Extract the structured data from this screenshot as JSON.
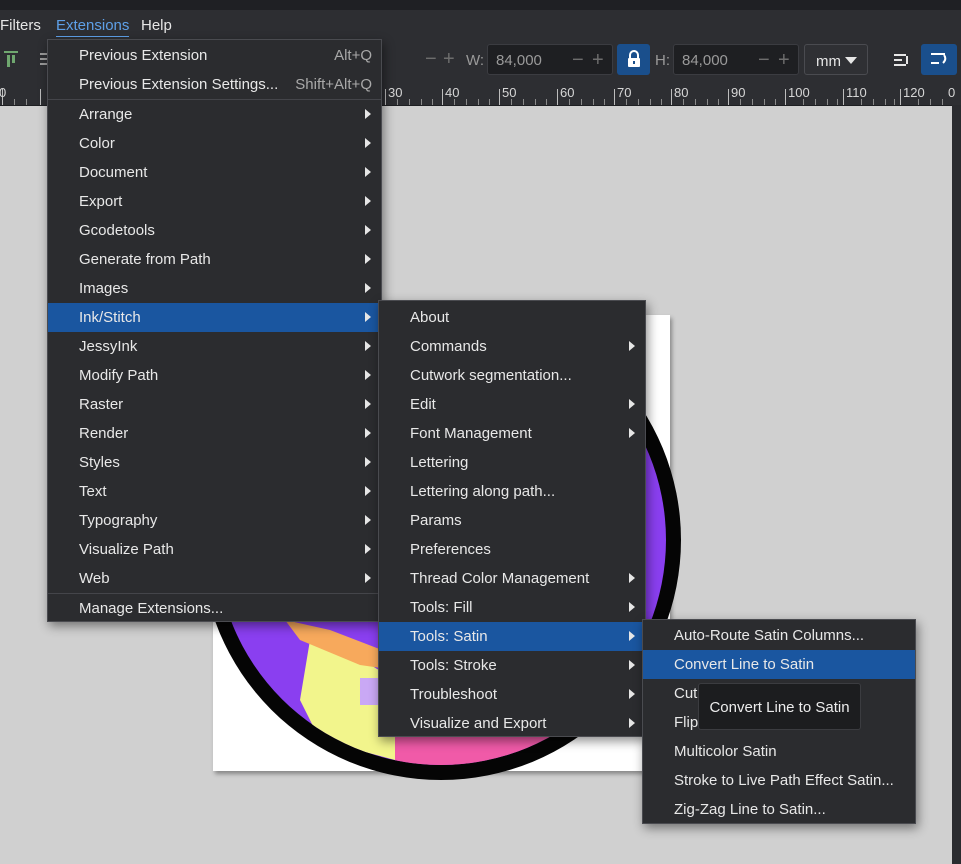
{
  "menubar": {
    "items": [
      "Filters",
      "Extensions",
      "Help"
    ]
  },
  "toolbar": {
    "w_label": "W:",
    "w_value": "84,000",
    "h_label": "H:",
    "h_value": "84,000",
    "unit": "mm",
    "minus": "−",
    "plus": "+"
  },
  "ruler": {
    "labels": [
      "0",
      "30",
      "40",
      "50",
      "60",
      "70",
      "80",
      "90",
      "100",
      "110",
      "120",
      "0"
    ]
  },
  "extensions_menu": {
    "previous_extension": {
      "label": "Previous Extension",
      "shortcut": "Alt+Q"
    },
    "previous_extension_settings": {
      "label": "Previous Extension Settings...",
      "shortcut": "Shift+Alt+Q"
    },
    "items": [
      "Arrange",
      "Color",
      "Document",
      "Export",
      "Gcodetools",
      "Generate from Path",
      "Images",
      "Ink/Stitch",
      "JessyInk",
      "Modify Path",
      "Raster",
      "Render",
      "Styles",
      "Text",
      "Typography",
      "Visualize Path",
      "Web"
    ],
    "highlighted": "Ink/Stitch",
    "manage": "Manage Extensions..."
  },
  "inkstitch_menu": {
    "items": [
      {
        "label": "About",
        "submenu": false
      },
      {
        "label": "Commands",
        "submenu": true
      },
      {
        "label": "Cutwork segmentation...",
        "submenu": false
      },
      {
        "label": "Edit",
        "submenu": true
      },
      {
        "label": "Font Management",
        "submenu": true
      },
      {
        "label": "Lettering",
        "submenu": false
      },
      {
        "label": "Lettering along path...",
        "submenu": false
      },
      {
        "label": "Params",
        "submenu": false
      },
      {
        "label": "Preferences",
        "submenu": false
      },
      {
        "label": "Thread Color Management",
        "submenu": true
      },
      {
        "label": "Tools: Fill",
        "submenu": true
      },
      {
        "label": "Tools: Satin",
        "submenu": true
      },
      {
        "label": "Tools: Stroke",
        "submenu": true
      },
      {
        "label": "Troubleshoot",
        "submenu": true
      },
      {
        "label": "Visualize and Export",
        "submenu": true
      }
    ],
    "highlighted": "Tools: Satin"
  },
  "satin_menu": {
    "items": [
      "Auto-Route Satin Columns...",
      "Convert Line to Satin",
      "Cut Satin Column",
      "Flip Satin Column Rails",
      "Multicolor Satin",
      "Stroke to Live Path Effect Satin...",
      "Zig-Zag Line to Satin..."
    ],
    "highlighted": "Convert Line to Satin"
  },
  "tooltip": "Convert Line to Satin",
  "icons": {
    "lock": "lock-icon",
    "unit_dropdown": "chevron-down-icon",
    "submenu": "chevron-right-icon"
  },
  "colors": {
    "menu_bg": "#2b2c2f",
    "highlight": "#1a56a0",
    "canvas": "#d0d0d0",
    "art_purple": "#8a3ff0",
    "art_pink": "#f05aa8",
    "art_yellow": "#f2f58c",
    "art_orange": "#f7a95c"
  }
}
